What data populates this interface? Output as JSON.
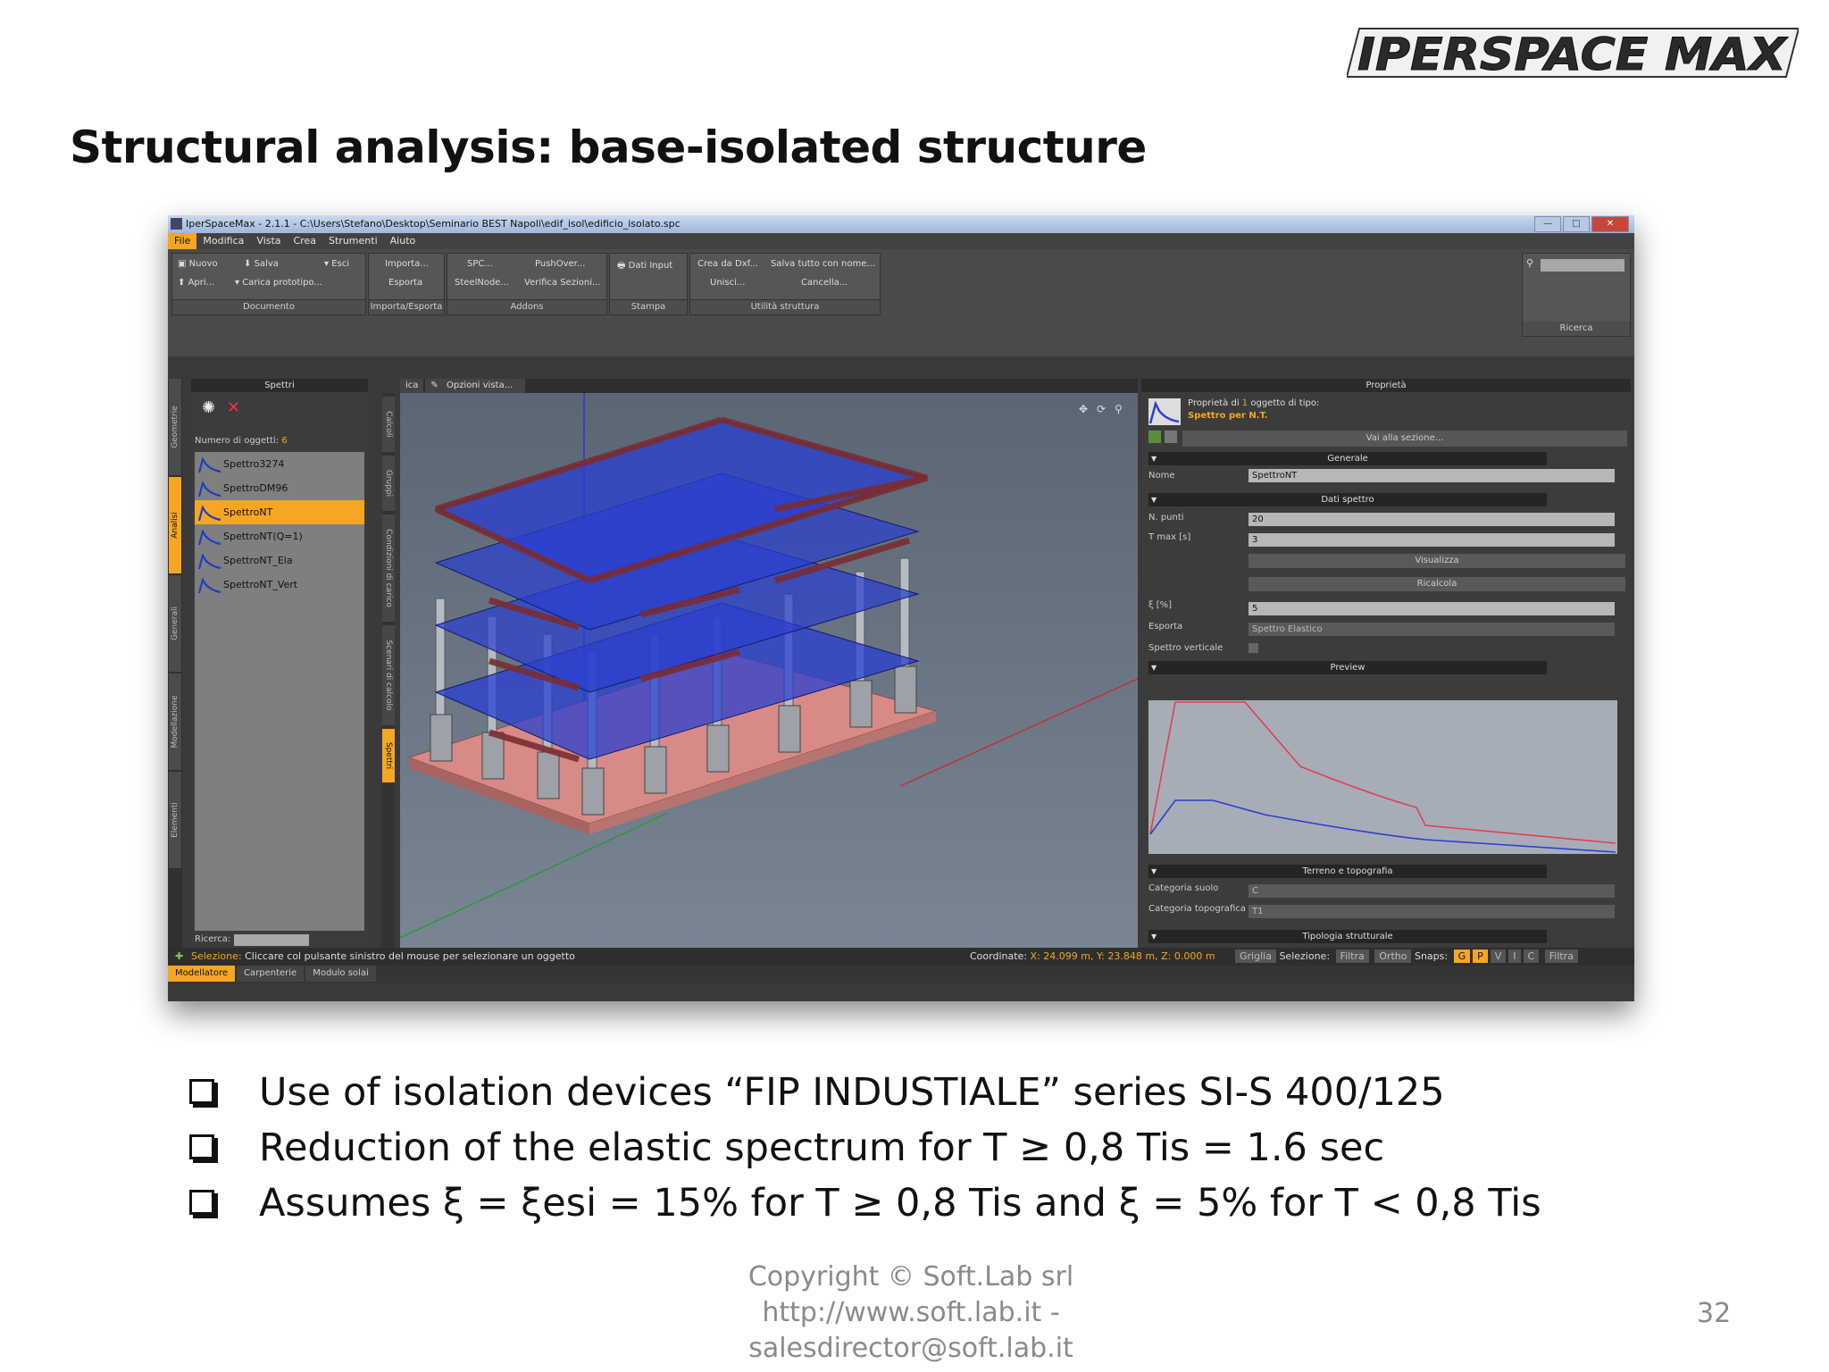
{
  "logo": {
    "text": "IPERSPACE MAX"
  },
  "slide": {
    "title": "Structural analysis: base-isolated structure",
    "bullets": [
      "Use of isolation devices “FIP INDUSTIALE” series SI-S 400/125",
      "Reduction of the elastic spectrum for T ≥ 0,8 Tis = 1.6 sec",
      "Assumes  ξ = ξesi = 15%  for  T ≥ 0,8 Tis  and  ξ = 5%   for  T < 0,8 Tis"
    ],
    "footer": [
      "Copyright © Soft.Lab  srl",
      "http://www.soft.lab.it -",
      "salesdirector@soft.lab.it"
    ],
    "page_number": "32"
  },
  "app": {
    "window_title": "IperSpaceMax - 2.1.1 - C:\\Users\\Stefano\\Desktop\\Seminario BEST Napoli\\edif_isol\\edificio_isolato.spc",
    "menu": [
      "File",
      "Modifica",
      "Vista",
      "Crea",
      "Strumenti",
      "Aiuto"
    ],
    "ribbon": {
      "documento": {
        "label": "Documento",
        "items": [
          "Nuovo",
          "Salva",
          "Esci",
          "Apri...",
          "Carica prototipo..."
        ]
      },
      "importa": {
        "label": "Importa/Esporta",
        "items": [
          "Importa...",
          "Esporta"
        ]
      },
      "addons": {
        "label": "Addons",
        "items": [
          "SPC...",
          "PushOver...",
          "SteelNode...",
          "Verifica Sezioni..."
        ]
      },
      "stampa": {
        "label": "Stampa",
        "items": [
          "Dati Input"
        ]
      },
      "utilita": {
        "label": "Utilità struttura",
        "items": [
          "Crea da Dxf...",
          "Salva tutto con nome...",
          "Unisci...",
          "Cancella..."
        ]
      },
      "ricerca": {
        "label": "Ricerca"
      }
    },
    "left_tabs": [
      "Geometrie",
      "Analisi",
      "Generali",
      "Modellazione",
      "Elementi"
    ],
    "spettri_panel": {
      "title": "Spettri",
      "count_label": "Numero di oggetti:",
      "count": "6",
      "items": [
        "Spettro3274",
        "SpettroDM96",
        "SpettroNT",
        "SpettroNT(Q=1)",
        "SpettroNT_Ela",
        "SpettroNT_Vert"
      ],
      "selected_index": 2,
      "search_label": "Ricerca:"
    },
    "mid_tabs": [
      "Calcoli",
      "Gruppi",
      "Condizioni di carico",
      "Scenari di calcolo",
      "Spettri"
    ],
    "viewport_tabs": [
      "ica",
      "Opzioni vista..."
    ],
    "properties": {
      "title": "Proprietà",
      "header_line1_pre": "Proprietà di",
      "header_count": "1",
      "header_line1_post": "oggetto di tipo:",
      "header_type": "Spettro per N.T.",
      "goto": "Vai alla sezione...",
      "sections": {
        "generale": "Generale",
        "dati": "Dati spettro",
        "preview": "Preview",
        "terreno": "Terreno e topografia",
        "tipologia": "Tipologia strutturale"
      },
      "fields": {
        "nome_label": "Nome",
        "nome": "SpettroNT",
        "npunti_label": "N. punti",
        "npunti": "20",
        "tmax_label": "T max [s]",
        "tmax": "3",
        "visualizza": "Visualizza",
        "ricalcola": "Ricalcola",
        "xi_label": "ξ [%]",
        "xi": "5",
        "esporta_label": "Esporta",
        "esporta": "Spettro Elastico",
        "verticale_label": "Spettro verticale",
        "cat_suolo_label": "Categoria suolo",
        "cat_suolo": "C",
        "cat_topo_label": "Categoria topografica",
        "cat_topo": "T1"
      },
      "colors": {
        "red_spectrum": "#e04050",
        "blue_spectrum": "#2a3fd0"
      }
    },
    "status": {
      "sel_label": "Selezione:",
      "sel_text": "Cliccare col pulsante sinistro del mouse per selezionare un oggetto",
      "coord_label": "Coordinate:",
      "coord_value": "X: 24.099 m, Y: 23.848 m, Z: 0.000 m",
      "griglia": "Griglia",
      "selezione": "Selezione:",
      "filtra": "Filtra",
      "ortho": "Ortho",
      "snaps": "Snaps:",
      "snap_chips": [
        "G",
        "P",
        "V",
        "I",
        "C"
      ],
      "filtra2": "Filtra"
    },
    "bottom_tabs": [
      "Modellatore",
      "Carpenterie",
      "Modulo solai"
    ],
    "accent": "#f5a623"
  }
}
